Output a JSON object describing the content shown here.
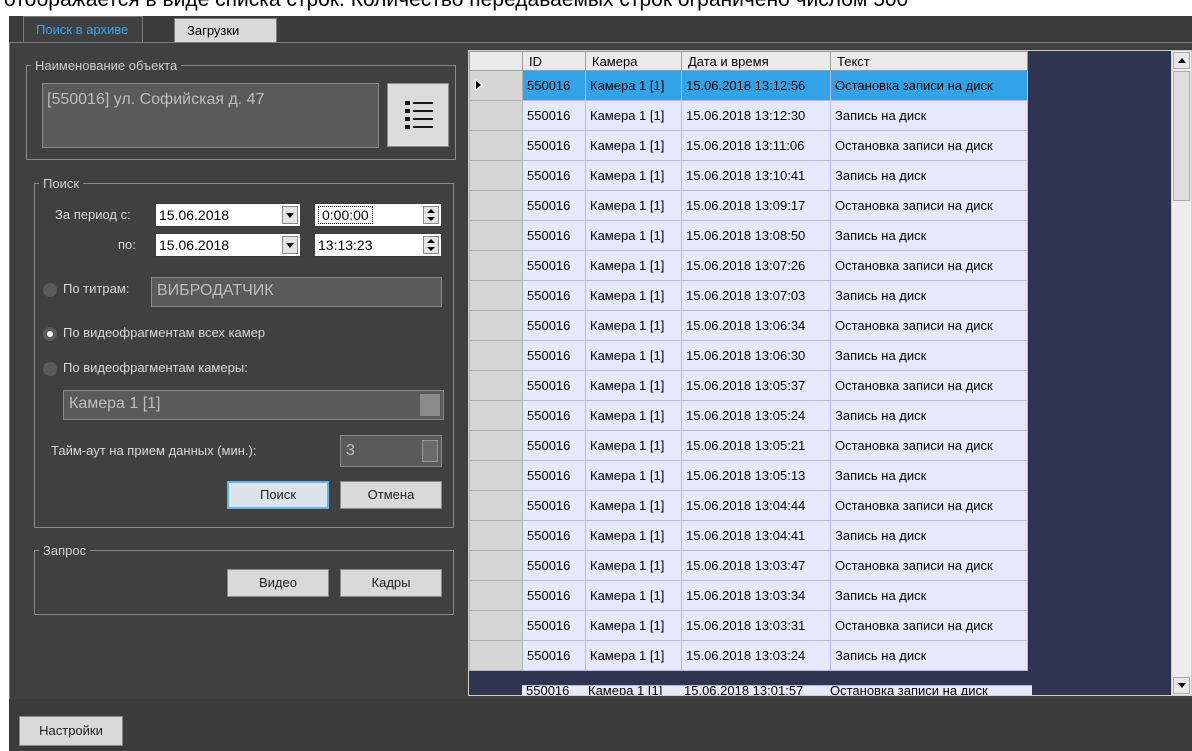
{
  "top_caption": "отображается в виде списка строк. Количество передаваемых строк ограничено числом 500",
  "tabs": [
    {
      "label": "Поиск в архиве"
    },
    {
      "label": "Загрузки"
    }
  ],
  "object_group": {
    "legend": "Наименование объекта",
    "value": "[550016] ул. Софийская д. 47",
    "list_button_icon": "list-icon"
  },
  "search_group": {
    "legend": "Поиск",
    "period_from_label": "За период с:",
    "period_to_label": "по:",
    "date_from": "15.06.2018",
    "time_from": "0:00:00",
    "date_to": "15.06.2018",
    "time_to": "13:13:23",
    "opt_titles_label": "По титрам:",
    "titles_value": "ВИБРОДАТЧИК",
    "opt_all_cameras_label": "По видеофрагментам всех камер",
    "opt_camera_label": "По видеофрагментам камеры:",
    "camera_value": "Камера 1 [1]",
    "timeout_label": "Тайм-аут на прием данных (мин.):",
    "timeout_value": "3",
    "search_button": "Поиск",
    "cancel_button": "Отмена"
  },
  "request_group": {
    "legend": "Запрос",
    "video_button": "Видео",
    "frames_button": "Кадры"
  },
  "settings_button": "Настройки",
  "grid": {
    "columns": [
      "ID",
      "Камера",
      "Дата и время",
      "Текст"
    ],
    "rows": [
      [
        "550016",
        "Камера 1 [1]",
        "15.06.2018 13:12:56",
        "Остановка записи на диск"
      ],
      [
        "550016",
        "Камера 1 [1]",
        "15.06.2018 13:12:30",
        "Запись на диск"
      ],
      [
        "550016",
        "Камера 1 [1]",
        "15.06.2018 13:11:06",
        "Остановка записи на диск"
      ],
      [
        "550016",
        "Камера 1 [1]",
        "15.06.2018 13:10:41",
        "Запись на диск"
      ],
      [
        "550016",
        "Камера 1 [1]",
        "15.06.2018 13:09:17",
        "Остановка записи на диск"
      ],
      [
        "550016",
        "Камера 1 [1]",
        "15.06.2018 13:08:50",
        "Запись на диск"
      ],
      [
        "550016",
        "Камера 1 [1]",
        "15.06.2018 13:07:26",
        "Остановка записи на диск"
      ],
      [
        "550016",
        "Камера 1 [1]",
        "15.06.2018 13:07:03",
        "Запись на диск"
      ],
      [
        "550016",
        "Камера 1 [1]",
        "15.06.2018 13:06:34",
        "Остановка записи на диск"
      ],
      [
        "550016",
        "Камера 1 [1]",
        "15.06.2018 13:06:30",
        "Запись на диск"
      ],
      [
        "550016",
        "Камера 1 [1]",
        "15.06.2018 13:05:37",
        "Остановка записи на диск"
      ],
      [
        "550016",
        "Камера 1 [1]",
        "15.06.2018 13:05:24",
        "Запись на диск"
      ],
      [
        "550016",
        "Камера 1 [1]",
        "15.06.2018 13:05:21",
        "Остановка записи на диск"
      ],
      [
        "550016",
        "Камера 1 [1]",
        "15.06.2018 13:05:13",
        "Запись на диск"
      ],
      [
        "550016",
        "Камера 1 [1]",
        "15.06.2018 13:04:44",
        "Остановка записи на диск"
      ],
      [
        "550016",
        "Камера 1 [1]",
        "15.06.2018 13:04:41",
        "Запись на диск"
      ],
      [
        "550016",
        "Камера 1 [1]",
        "15.06.2018 13:03:47",
        "Остановка записи на диск"
      ],
      [
        "550016",
        "Камера 1 [1]",
        "15.06.2018 13:03:34",
        "Запись на диск"
      ],
      [
        "550016",
        "Камера 1 [1]",
        "15.06.2018 13:03:31",
        "Остановка записи на диск"
      ],
      [
        "550016",
        "Камера 1 [1]",
        "15.06.2018 13:03:24",
        "Запись на диск"
      ]
    ],
    "selected_row": 0,
    "partial_row": [
      "550016",
      "Камера 1 [1]",
      "15.06.2018 13:01:57",
      "Остановка записи на диск"
    ]
  },
  "colors": {
    "selection": "#33a3e8",
    "active_tab_text": "#35a6f2",
    "panel_bg": "#404040",
    "grid_bg": "#2f3450"
  }
}
